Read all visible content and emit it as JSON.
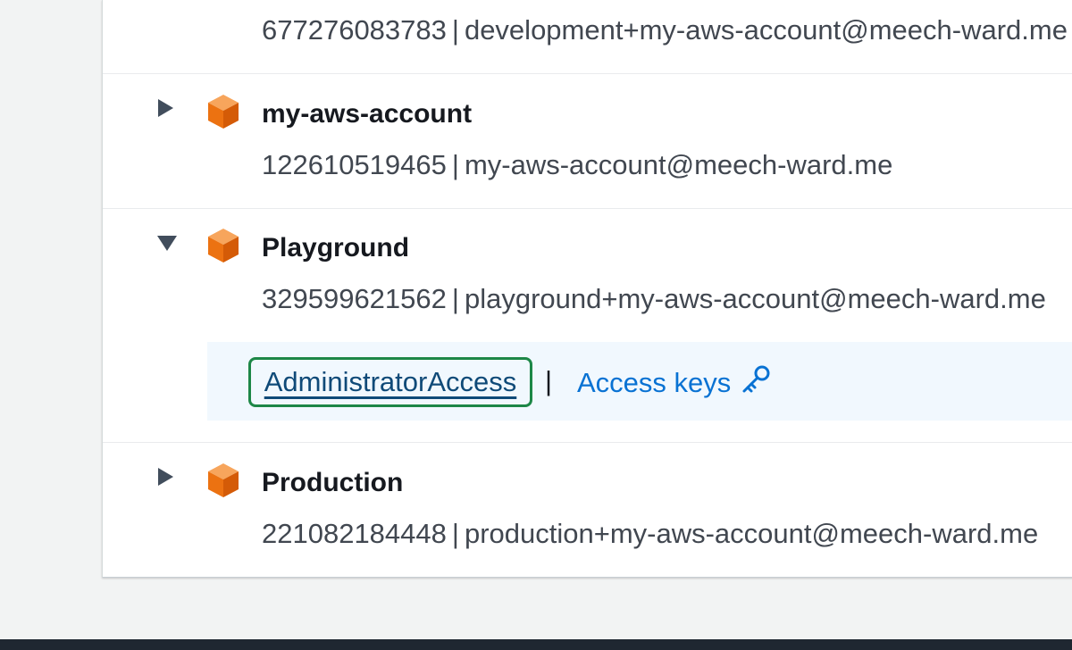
{
  "accounts": [
    {
      "name": "",
      "id": "677276083783",
      "email": "development+my-aws-account@meech-ward.me",
      "expanded": false
    },
    {
      "name": "my-aws-account",
      "id": "122610519465",
      "email": "my-aws-account@meech-ward.me",
      "expanded": false
    },
    {
      "name": "Playground",
      "id": "329599621562",
      "email": "playground+my-aws-account@meech-ward.me",
      "expanded": true,
      "roles": {
        "role_name": "AdministratorAccess",
        "separator": "|",
        "access_keys_label": "Access keys"
      }
    },
    {
      "name": "Production",
      "id": "221082184448",
      "email": "production+my-aws-account@meech-ward.me",
      "expanded": false
    }
  ],
  "separator": "|",
  "colors": {
    "page_bg": "#f2f3f3",
    "panel_bg": "#ffffff",
    "account_icon": "#ec7211",
    "link": "#0972d3",
    "role_link": "#0f4a78",
    "focus_ring": "#1d8747",
    "roles_bg": "#f1f8fe",
    "bottom_bar": "#1f2731"
  },
  "icons": {
    "collapsed": "caret-right-icon",
    "expanded": "caret-down-icon",
    "account": "aws-account-cube-icon",
    "access_keys": "key-icon"
  }
}
